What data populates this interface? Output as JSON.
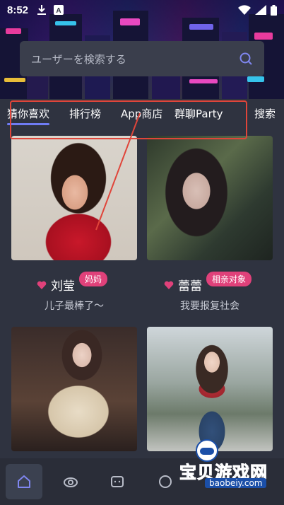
{
  "status_bar": {
    "time": "8:52"
  },
  "search": {
    "placeholder": "ユーザーを検索する"
  },
  "tabs": [
    {
      "label": "猜你喜欢",
      "active": true
    },
    {
      "label": "排行榜"
    },
    {
      "label": "App商店"
    },
    {
      "label": "群聊Party"
    },
    {
      "label": "搜索"
    }
  ],
  "cards": [
    {
      "name": "刘莹",
      "badge": "妈妈",
      "tagline": "儿子最棒了～"
    },
    {
      "name": "蕾蕾",
      "badge": "相亲对象",
      "tagline": "我要报复社会"
    },
    {
      "name": "",
      "badge": "",
      "tagline": ""
    },
    {
      "name": "",
      "badge": "",
      "tagline": ""
    }
  ],
  "bottom_nav": [
    {
      "icon": "home-icon",
      "active": true
    },
    {
      "icon": "discover-icon"
    },
    {
      "icon": "chat-icon"
    },
    {
      "icon": "community-icon"
    },
    {
      "icon": "settings-icon"
    }
  ],
  "watermark": {
    "text": "宝贝游戏网",
    "url": "baobeiy.com"
  },
  "colors": {
    "accent": "#6f7cf5",
    "badge": "#e0417a",
    "highlight": "#e0453a",
    "background": "#2f3340"
  }
}
